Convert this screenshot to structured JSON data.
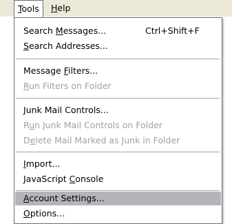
{
  "menubar": {
    "tools": {
      "pre": "",
      "key": "T",
      "post": "ools"
    },
    "help": {
      "pre": "",
      "key": "H",
      "post": "elp"
    }
  },
  "menu": {
    "search_messages": {
      "pre": "Search ",
      "key": "M",
      "post": "essages...",
      "shortcut": "Ctrl+Shift+F"
    },
    "search_addresses": {
      "pre": "",
      "key": "S",
      "post": "earch Addresses..."
    },
    "message_filters": {
      "pre": "Message ",
      "key": "F",
      "post": "ilters..."
    },
    "run_filters": {
      "pre": "",
      "key": "R",
      "post": "un Filters on Folder"
    },
    "junk_controls": {
      "pre": "",
      "key": "J",
      "post": "unk Mail Controls..."
    },
    "run_junk": {
      "pre": "R",
      "key": "u",
      "post": "n Junk Mail Controls on Folder"
    },
    "delete_junk": {
      "pre": "D",
      "key": "e",
      "post": "lete Mail Marked as Junk in Folder"
    },
    "import": {
      "pre": "",
      "key": "I",
      "post": "mport..."
    },
    "js_console": {
      "pre": "JavaScript ",
      "key": "C",
      "post": "onsole"
    },
    "account_settings": {
      "pre": "",
      "key": "A",
      "post": "ccount Settings..."
    },
    "options": {
      "pre": "",
      "key": "O",
      "post": "ptions..."
    }
  }
}
